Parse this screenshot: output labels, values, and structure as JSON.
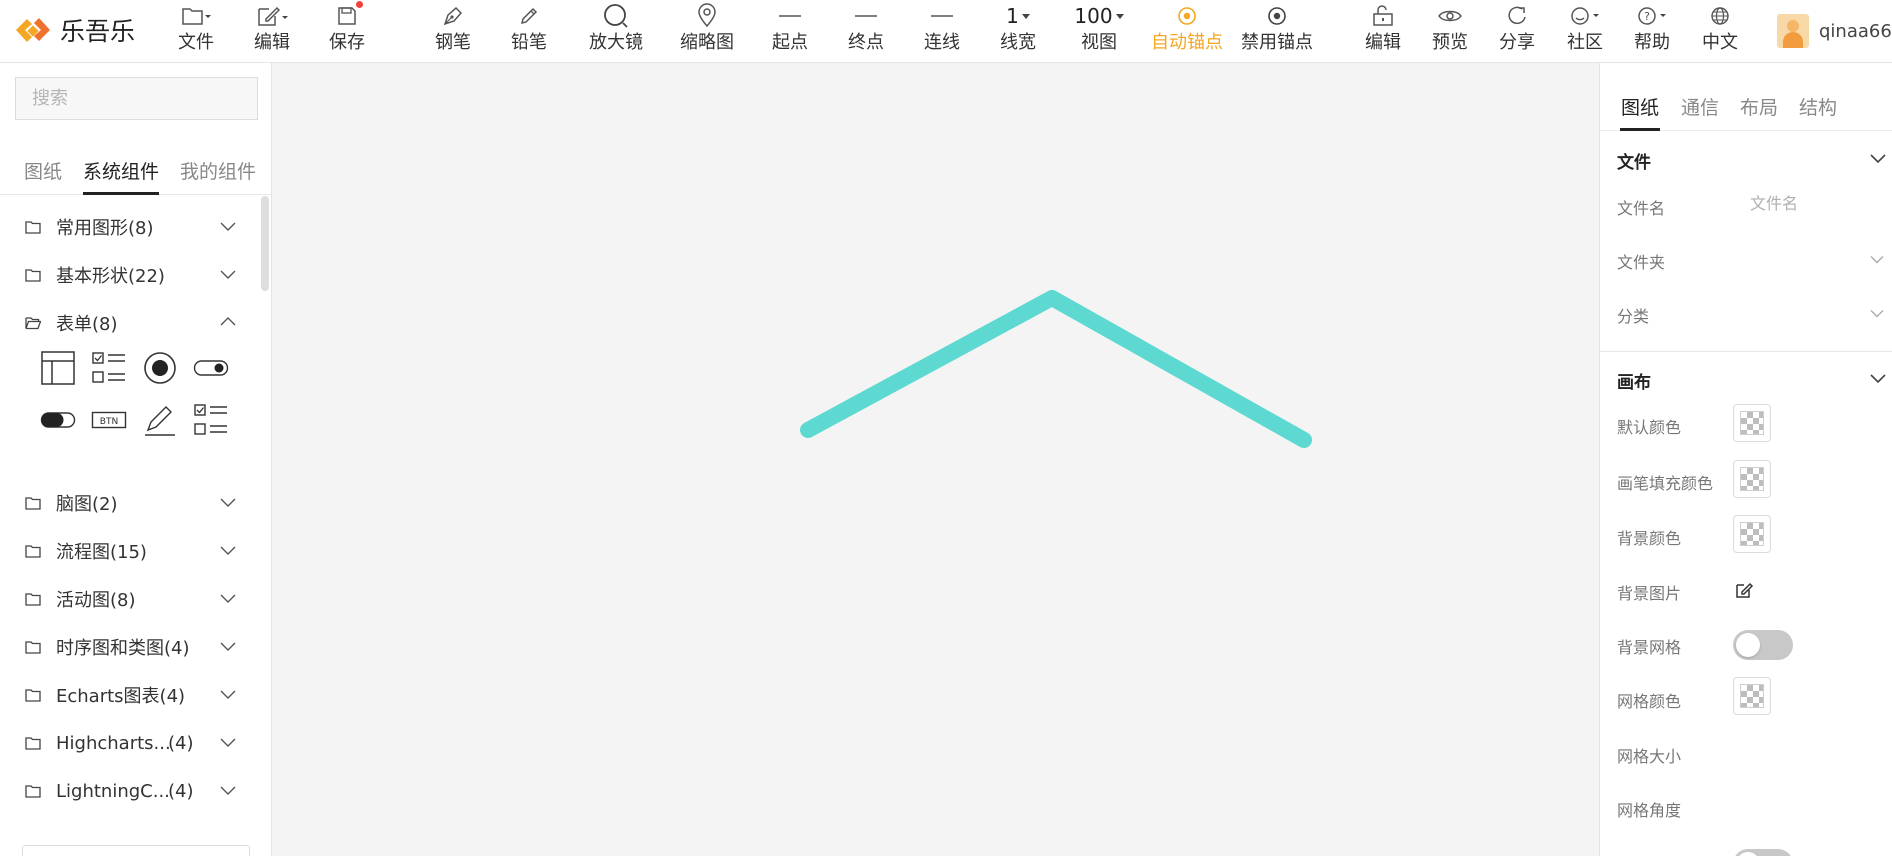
{
  "app": {
    "name": "乐吾乐",
    "brand_color": "#f5a623"
  },
  "toolbar": {
    "file_label": "文件",
    "edit_label": "编辑",
    "save_label": "保存",
    "pen_label": "钢笔",
    "pencil_label": "铅笔",
    "magnifier_label": "放大镜",
    "minimap_label": "缩略图",
    "start_label": "起点",
    "end_label": "终点",
    "line_label": "连线",
    "linewidth_value": "1",
    "linewidth_label": "线宽",
    "zoom_value": "100",
    "view_label": "视图",
    "auto_anchor_label": "自动锚点",
    "disable_anchor_label": "禁用锚点",
    "edit2_label": "编辑",
    "preview_label": "预览",
    "share_label": "分享",
    "community_label": "社区",
    "help_label": "帮助",
    "language_label": "中文"
  },
  "user": {
    "name": "qinaa66"
  },
  "left": {
    "search_placeholder": "搜索",
    "tabs": [
      "图纸",
      "系统组件",
      "我的组件"
    ],
    "active_tab": "系统组件",
    "categories": [
      {
        "label": "常用图形(8)",
        "num": "",
        "expanded": false
      },
      {
        "label": "基本形状(22)",
        "num": "",
        "expanded": false
      },
      {
        "label": "表单(8)",
        "num": "",
        "expanded": true
      },
      {
        "label": "脑图(2)",
        "num": "",
        "expanded": false
      },
      {
        "label": "流程图(15)",
        "num": "",
        "expanded": false
      },
      {
        "label": "活动图(8)",
        "num": "",
        "expanded": false
      },
      {
        "label": "时序图和类图(4)",
        "num": "",
        "expanded": false
      },
      {
        "label": "Echarts图表(4)",
        "num": "",
        "expanded": false
      },
      {
        "label": "Highcharts...",
        "num": "(4)",
        "expanded": false
      },
      {
        "label": "LightningC...",
        "num": "(4)",
        "expanded": false
      }
    ],
    "form_widgets": [
      "table-icon",
      "checklist-icon",
      "radio-icon",
      "switch-on-icon",
      "switch-off-icon",
      "button-icon",
      "signature-icon",
      "checklist-icon"
    ],
    "form_widget_text": {
      "button": "BTN"
    }
  },
  "canvas": {
    "line_color": "#5ed9d1"
  },
  "right": {
    "tabs": [
      "图纸",
      "通信",
      "布局",
      "结构"
    ],
    "active_tab": "图纸",
    "file_section": {
      "title": "文件",
      "filename_label": "文件名",
      "filename_placeholder": "文件名",
      "folder_label": "文件夹",
      "category_label": "分类"
    },
    "canvas_section": {
      "title": "画布",
      "default_color_label": "默认颜色",
      "brush_fill_label": "画笔填充颜色",
      "bg_color_label": "背景颜色",
      "bg_image_label": "背景图片",
      "bg_grid_label": "背景网格",
      "grid_color_label": "网格颜色",
      "grid_size_label": "网格大小",
      "grid_angle_label": "网格角度"
    }
  }
}
